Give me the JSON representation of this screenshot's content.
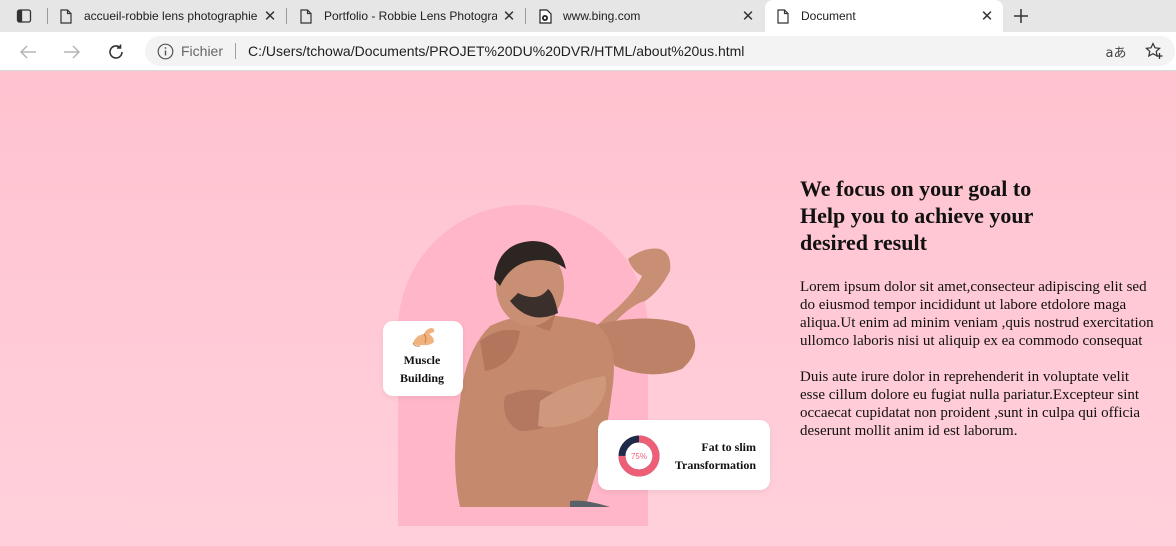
{
  "browser": {
    "tabs": [
      {
        "title": "accueil-robbie lens photographie",
        "active": false
      },
      {
        "title": "Portfolio - Robbie Lens Photography",
        "active": false
      },
      {
        "title": "www.bing.com",
        "active": false
      },
      {
        "title": "Document",
        "active": true
      }
    ],
    "close_glyph": "✕",
    "new_tab_glyph": "+",
    "address": {
      "origin_label": "Fichier",
      "url": "C:/Users/tchowa/Documents/PROJET%20DU%20DVR/HTML/about%20us.html",
      "read_aloud_glyph": "aあ"
    }
  },
  "page": {
    "heading": "We focus on your goal to Help you to achieve your desired result",
    "paragraphs": [
      "Lorem ipsum dolor sit amet,consecteur adipiscing elit sed do eiusmod tempor incididunt ut labore etdolore maga aliqua.Ut enim ad minim veniam ,quis nostrud exercitation ullomco laboris nisi ut aliquip ex ea commodo consequat",
      "Duis aute irure dolor in reprehenderit in voluptate velit esse cillum dolore eu fugiat nulla pariatur.Excepteur sint occaecat cupidatat non proident ,sunt in culpa qui officia deserunt mollit anim id est laborum."
    ],
    "cards": {
      "muscle": {
        "line1": "Muscle",
        "line2": "Building"
      },
      "fat": {
        "line1": "Fat to slim",
        "line2": "Transformation",
        "progress_label": "75%",
        "progress": 0.75
      }
    },
    "colors": {
      "background": "#ffc6d2",
      "arch": "#ffb6c8",
      "ring_fill": "#ef5e77",
      "ring_track": "#1e2a4a"
    }
  }
}
